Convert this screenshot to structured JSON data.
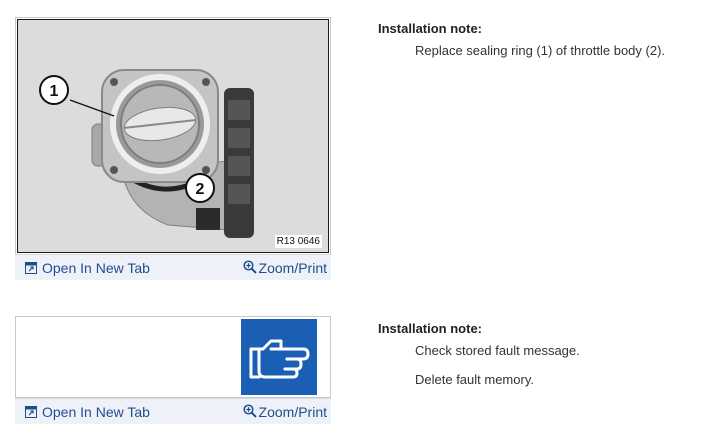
{
  "figures": [
    {
      "image_ref": "R13 0646",
      "callouts": [
        "1",
        "2"
      ],
      "links": {
        "open_label": "Open In New Tab",
        "zoom_label": "Zoom/Print"
      }
    },
    {
      "icon": "pointing-hand-icon",
      "links": {
        "open_label": "Open In New Tab",
        "zoom_label": "Zoom/Print"
      }
    }
  ],
  "notes": [
    {
      "title": "Installation note:",
      "lines": [
        "Replace sealing ring (1) of throttle body (2)."
      ]
    },
    {
      "title": "Installation note:",
      "lines": [
        "Check stored fault message.",
        "Delete fault memory."
      ]
    }
  ],
  "colors": {
    "link": "#1f4e8c",
    "icon_tile": "#1b5fb5",
    "link_bar": "#eef2f8"
  }
}
